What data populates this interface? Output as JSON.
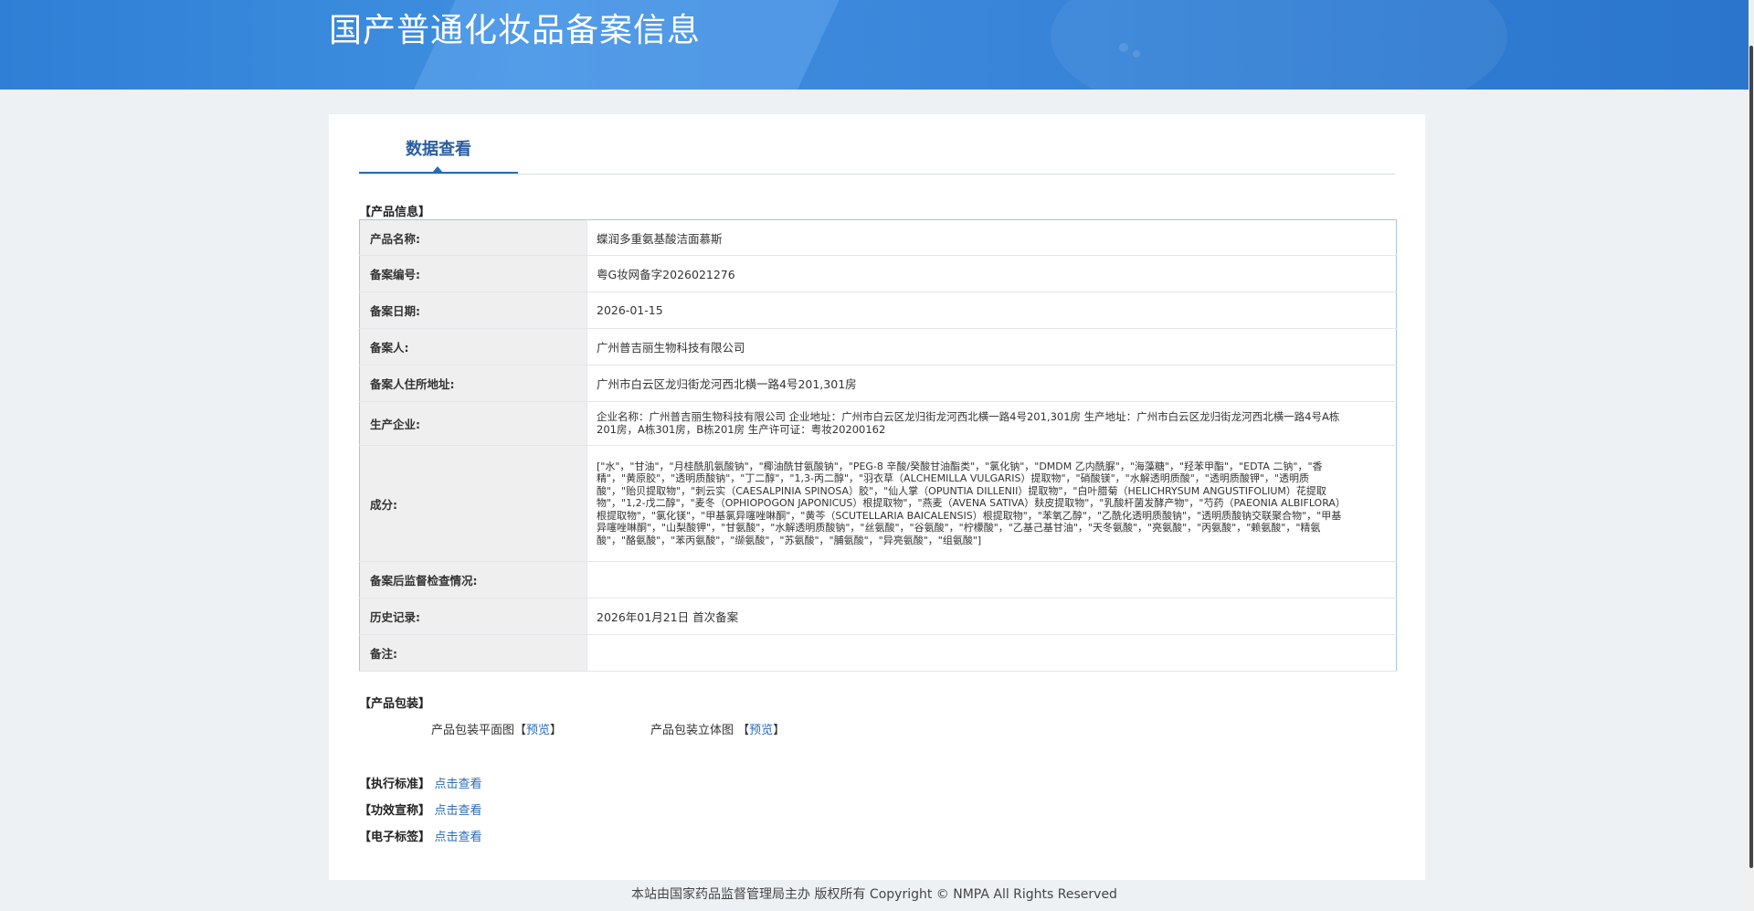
{
  "header": {
    "title": "国产普通化妆品备案信息"
  },
  "tab": {
    "label": "数据查看"
  },
  "product_section": {
    "title": "【产品信息】"
  },
  "rows": [
    {
      "label": "产品名称:",
      "value": "蝶润多重氨基酸洁面慕斯"
    },
    {
      "label": "备案编号:",
      "value": "粤G妆网备字2026021276"
    },
    {
      "label": "备案日期:",
      "value": "2026-01-15"
    },
    {
      "label": "备案人:",
      "value": "广州普吉丽生物科技有限公司"
    },
    {
      "label": "备案人住所地址:",
      "value": "广州市白云区龙归街龙河西北横一路4号201,301房"
    },
    {
      "label": "生产企业:",
      "value": "企业名称：广州普吉丽生物科技有限公司 企业地址：广州市白云区龙归街龙河西北横一路4号201,301房 生产地址：广州市白云区龙归街龙河西北横一路4号A栋201房，A栋301房，B栋201房 生产许可证：粤妆20200162"
    },
    {
      "label": "成分:",
      "value": "[\"水\"，\"甘油\"，\"月桂酰肌氨酸钠\"，\"椰油酰甘氨酸钠\"，\"PEG-8 辛酸/癸酸甘油酯类\"，\"氯化钠\"，\"DMDM 乙内酰脲\"，\"海藻糖\"，\"羟苯甲酯\"，\"EDTA 二钠\"，\"香精\"，\"黄原胶\"，\"透明质酸钠\"，\"丁二醇\"，\"1,3-丙二醇\"，\"羽衣草（ALCHEMILLA VULGARIS）提取物\"，\"硝酸镁\"，\"水解透明质酸\"，\"透明质酸钾\"，\"透明质酸\"，\"贻贝提取物\"，\"刺云实（CAESALPINIA SPINOSA）胶\"，\"仙人掌（OPUNTIA DILLENII）提取物\"，\"白叶腊菊（HELICHRYSUM ANGUSTIFOLIUM）花提取物\"，\"1,2-戊二醇\"，\"麦冬（OPHIOPOGON JAPONICUS）根提取物\"，\"燕麦（AVENA SATIVA）麸皮提取物\"，\"乳酸杆菌发酵产物\"，\"芍药（PAEONIA ALBIFLORA）根提取物\"，\"氯化镁\"，\"甲基氯异噻唑啉酮\"，\"黄芩（SCUTELLARIA BAICALENSIS）根提取物\"，\"苯氧乙醇\"，\"乙酰化透明质酸钠\"，\"透明质酸钠交联聚合物\"，\"甲基异噻唑啉酮\"，\"山梨酸钾\"，\"甘氨酸\"，\"水解透明质酸钠\"，\"丝氨酸\"，\"谷氨酸\"，\"柠檬酸\"，\"乙基己基甘油\"，\"天冬氨酸\"，\"亮氨酸\"，\"丙氨酸\"，\"赖氨酸\"，\"精氨酸\"，\"酪氨酸\"，\"苯丙氨酸\"，\"缬氨酸\"，\"苏氨酸\"，\"脯氨酸\"，\"异亮氨酸\"，\"组氨酸\"]"
    },
    {
      "label": "备案后监督检查情况:",
      "value": ""
    },
    {
      "label": "历史记录:",
      "value": "2026年01月21日 首次备案"
    },
    {
      "label": "备注:",
      "value": ""
    }
  ],
  "packaging": {
    "title": "【产品包装】",
    "flat_label": "产品包装平面图",
    "solid_label": "产品包装立体图",
    "bracket_open": "【",
    "bracket_close": "】",
    "preview": "预览"
  },
  "links": [
    {
      "label": "【执行标准】",
      "action": "点击查看"
    },
    {
      "label": "【功效宣称】",
      "action": "点击查看"
    },
    {
      "label": "【电子标签】",
      "action": "点击查看"
    }
  ],
  "footer": {
    "text": "本站由国家药品监督管理局主办 版权所有 Copyright © NMPA All Rights Reserved"
  }
}
